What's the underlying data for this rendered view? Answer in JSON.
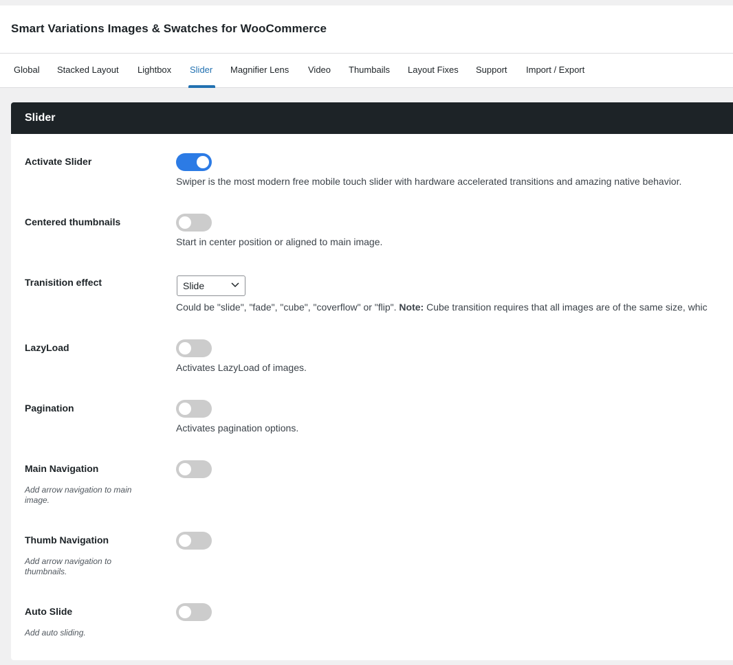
{
  "app": {
    "title": "Smart Variations Images & Swatches for WooCommerce"
  },
  "tabs": [
    {
      "label": "Global"
    },
    {
      "label": "Stacked Layout"
    },
    {
      "label": "Lightbox"
    },
    {
      "label": "Slider",
      "active": true
    },
    {
      "label": "Magnifier Lens"
    },
    {
      "label": "Video"
    },
    {
      "label": "Thumbails"
    },
    {
      "label": "Layout Fixes"
    },
    {
      "label": "Support"
    },
    {
      "label": "Import / Export"
    }
  ],
  "panel": {
    "title": "Slider"
  },
  "settings": {
    "activate_slider": {
      "label": "Activate Slider",
      "enabled": true,
      "desc": "Swiper is the most modern free mobile touch slider with hardware accelerated transitions and amazing native behavior."
    },
    "centered_thumbnails": {
      "label": "Centered thumbnails",
      "enabled": false,
      "desc": "Start in center position or aligned to main image."
    },
    "transition_effect": {
      "label": "Tranisition effect",
      "value": "Slide",
      "desc_pre": "Could be \"slide\", \"fade\", \"cube\", \"coverflow\" or \"flip\". ",
      "desc_bold": "Note:",
      "desc_post": " Cube transition requires that all images are of the same size, whic"
    },
    "lazyload": {
      "label": "LazyLoad",
      "enabled": false,
      "desc": "Activates LazyLoad of images."
    },
    "pagination": {
      "label": "Pagination",
      "enabled": false,
      "desc": "Activates pagination options."
    },
    "main_navigation": {
      "label": "Main Navigation",
      "enabled": false,
      "sub": "Add arrow navigation to main image."
    },
    "thumb_navigation": {
      "label": "Thumb Navigation",
      "enabled": false,
      "sub": "Add arrow navigation to thumbnails."
    },
    "auto_slide": {
      "label": "Auto Slide",
      "enabled": false,
      "sub": "Add auto sliding."
    }
  },
  "colors": {
    "accent": "#2271b1",
    "toggle_on": "#2c7be5",
    "toggle_off": "#cccccc",
    "panel_header": "#1d2327"
  }
}
